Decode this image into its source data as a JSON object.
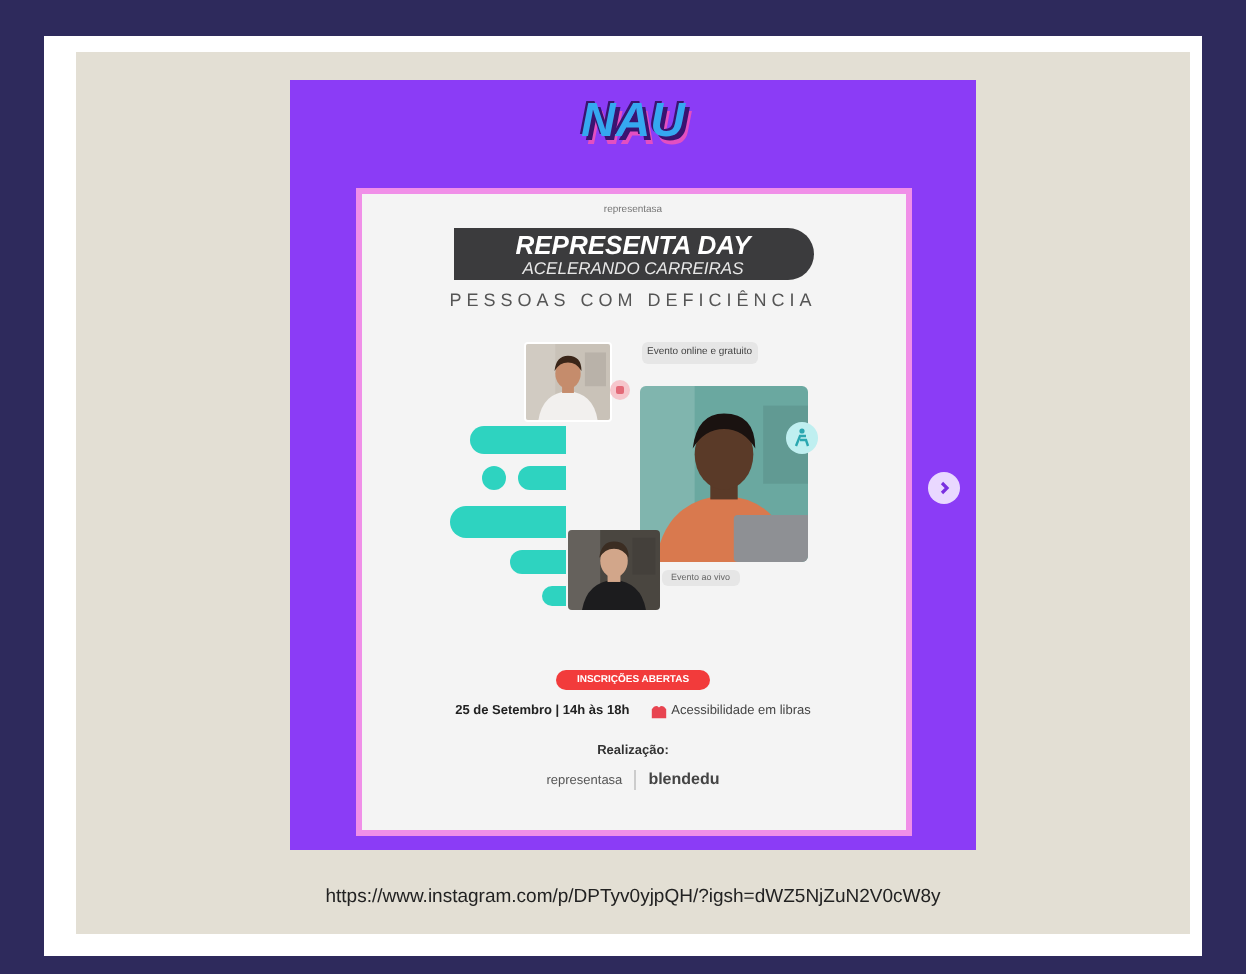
{
  "post": {
    "logo": "NAU",
    "brand_small": "representasa",
    "title": "REPRESENTA DAY",
    "subtitle": "ACELERANDO CARREIRAS",
    "tagline": "PESSOAS COM DEFICIÊNCIA",
    "chips": [
      "Evento online e gratuito",
      "Evento ao vivo"
    ],
    "cta": "INSCRIÇÕES ABERTAS",
    "date": "25 de Setembro | 14h às 18h",
    "accessibility": "Acessibilidade em libras",
    "credits_label": "Realização:",
    "partners": [
      "representasa",
      "blendedu"
    ]
  },
  "caption": "https://www.instagram.com/p/DPTyv0yjpQH/?igsh=dWZ5NjZuN2V0cW8y"
}
